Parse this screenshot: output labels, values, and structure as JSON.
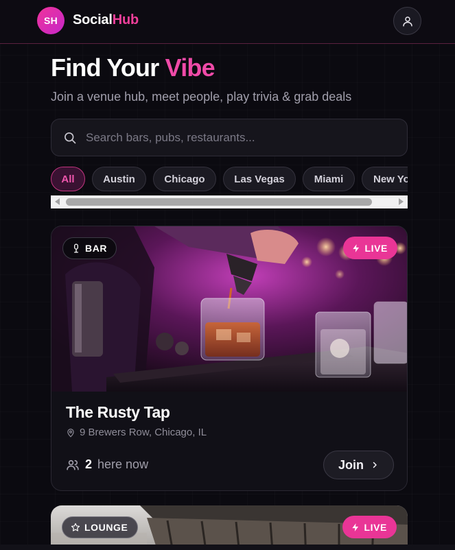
{
  "header": {
    "logo_initials": "SH",
    "brand_part1": "Social",
    "brand_part2": "Hub",
    "profile_icon": "user-icon"
  },
  "hero": {
    "title_part1": "Find Your ",
    "title_part2": "Vibe",
    "subtitle": "Join a venue hub, meet people, play trivia & grab deals"
  },
  "search": {
    "placeholder": "Search bars, pubs, restaurants...",
    "icon": "search-icon"
  },
  "filters": {
    "selected": "All",
    "chips": [
      "All",
      "Austin",
      "Chicago",
      "Las Vegas",
      "Miami",
      "New York"
    ]
  },
  "venues": [
    {
      "type_label": "BAR",
      "type_icon": "microphone-icon",
      "live_label": "LIVE",
      "live_icon": "lightning-icon",
      "name": "The Rusty Tap",
      "address": "9 Brewers Row, Chicago, IL",
      "here_count": "2",
      "here_label": "here now",
      "join_label": "Join"
    },
    {
      "type_label": "LOUNGE",
      "type_icon": "star-icon",
      "live_label": "LIVE",
      "live_icon": "lightning-icon"
    }
  ],
  "colors": {
    "accent": "#ef3f9a",
    "background": "#0b0a10",
    "card": "#111017",
    "live_badge": "#e93596"
  }
}
